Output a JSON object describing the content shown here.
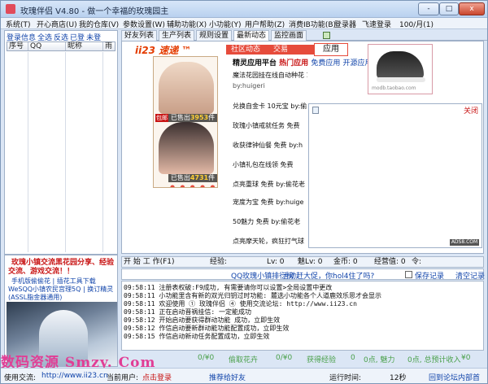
{
  "window": {
    "title": "玫瑰伴侣 V4.80 - 做一个幸福的玫瑰园主",
    "min_label": "-",
    "max_label": "□",
    "close_label": "x"
  },
  "menu": {
    "items": [
      "系统(T)",
      "开心商店(U)",
      "我的仓库(V)",
      "参数设置(W)",
      "辅助功能(X)",
      "小功能(Y)",
      "用户帮助(Z)",
      "消费IB功能(B)",
      "登录器",
      "飞速登录",
      "100/月(1)"
    ]
  },
  "left_panel": {
    "links": [
      "登录信息",
      "全选",
      "反选",
      "已登",
      "未登"
    ],
    "columns": [
      "序号",
      "QQ",
      "昵称",
      "雨"
    ]
  },
  "promo": {
    "line1": "玫瑰小镇交流黑花园分享、经验",
    "line2": "交流、游戏交流！！",
    "line3": "手机版偷偷花 | 插花工具下载",
    "line4": "WeSQQ小镇农民宫理5Q | 换订精灵",
    "line5": "(ASSL脂金器通用)"
  },
  "tabs": [
    "好友列表",
    "生产列表",
    "规则设置",
    "最新动态",
    "监控画面"
  ],
  "active_tab": "最新动态",
  "browser": {
    "logo": "ii23 速递 ™",
    "nav": [
      "社区动态",
      "交易",
      "应用"
    ],
    "header_prefix": "精灵应用平台",
    "header_hot": "热门应用",
    "header_free": "免费应用",
    "header_open": "开源应用",
    "posts": [
      {
        "title": "魔法花园挂在线自动种花 10元宝",
        "author": "by:huigeri"
      },
      {
        "title": "兑换自金卡 10元宝 by:偷",
        "author": ""
      },
      {
        "title": "玫瑰小镇戒就任务 免费",
        "author": ""
      },
      {
        "title": "收获律钟仙餐 免费 by:h",
        "author": ""
      },
      {
        "title": "小镇礼包在线领 免费",
        "author": ""
      },
      {
        "title": "点亮重球 免费 by:偷花老",
        "author": ""
      },
      {
        "title": "宠度为宝 免费 by:huige",
        "author": ""
      },
      {
        "title": "50魅力 免费 by:偷花老",
        "author": ""
      },
      {
        "title": "点亮摩天轮，疯狂打气球",
        "author": ""
      }
    ],
    "caption1_prefix": "已售出",
    "caption1_value": "3953",
    "caption1_suffix": "件",
    "caption2_prefix": "已售出",
    "caption2_value": "4731",
    "caption2_suffix": "件",
    "badge": "包邮",
    "dots": "● ● ● ● ●",
    "shoe_mark": "modb.taobao.com"
  },
  "popup": {
    "close": "关闭",
    "ads": "ADS8.COM"
  },
  "command_bar": {
    "start": "开 始 工 作(F1)",
    "exp": "经验:",
    "lv": "Lv: 0",
    "melv": "魅Lv: 0",
    "coins": "金币: 0",
    "jingying": "经营值: 0",
    "ling": "令:"
  },
  "row_bar": {
    "rank": "QQ玫瑰小镇排行榜",
    "activity": "活动赶大促，你hol4住了吗?",
    "save_log": "保存记录",
    "clear_log": "清空记录"
  },
  "log": [
    "09:58:11 注册表权破:F9成功, 有需要请你可以设置>全局设置中更改",
    "09:58:11 小功能里含有新的双光归钥过时功能: 麓选小功能各个人道鹿效乐思才会显示",
    "09:58:11 欢迎使用 ① 玫瑰伴侣 ④ 使用交流论坛: http://www.ii23.cn",
    "09:58:11 正在启动晋祸挂信: 一定能成功",
    "09:58:12 开始启动要获得群动功能 成功，立即生效",
    "09:58:12 作信启动要新群动能功能配置成功，立即生效",
    "09:58:15 作信启动新动任务配置成功，立即生效"
  ],
  "watermark": "数码资源 Smzy. Com",
  "status_row": {
    "a": "0/¥0",
    "b": "偷取花卉",
    "c": "0/¥0",
    "d": "获得经验",
    "e": "0",
    "f": "0点, 魅力",
    "g": "0点, 总预计收入",
    "h": "¥0"
  },
  "status_bar": {
    "usage_label": "使用交流:",
    "usage_link": "http://www.ii23.cn",
    "user_label": "当前用户:",
    "user_value": "点击登录",
    "recommend": "推荐给好友",
    "runtime_label": "运行时间:",
    "runtime_value": "12秒",
    "return": "回到论坛内部首"
  },
  "colors": {
    "accent_red": "#c81414",
    "link_blue": "#1144aa",
    "nav_red": "#e64b3b"
  }
}
